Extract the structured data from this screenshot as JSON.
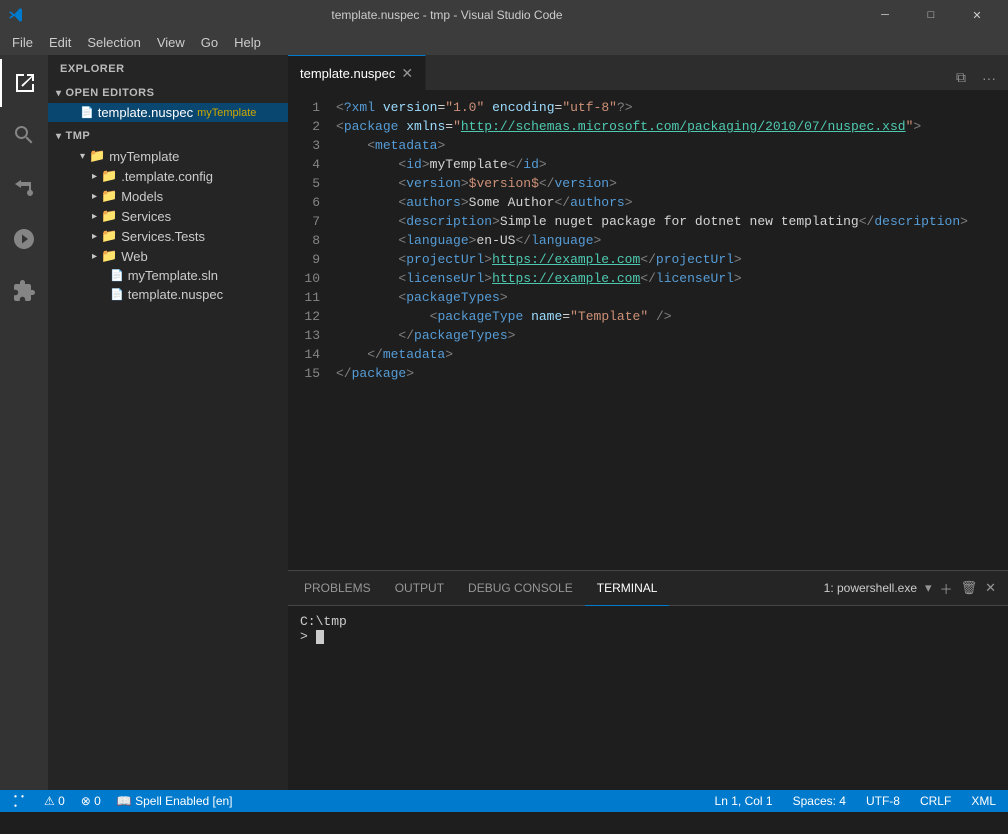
{
  "titlebar": {
    "title": "template.nuspec - tmp - Visual Studio Code",
    "icon": "⚡",
    "minimize": "─",
    "maximize": "□",
    "close": "✕"
  },
  "menubar": {
    "items": [
      "File",
      "Edit",
      "Selection",
      "View",
      "Go",
      "Help"
    ]
  },
  "sidebar": {
    "title": "Explorer",
    "sections": {
      "open_editors": "Open Editors",
      "tmp": "TMP"
    },
    "open_editors_items": [
      {
        "name": "template.nuspec",
        "badge": "myTemplate"
      }
    ],
    "tree": [
      {
        "label": "myTemplate",
        "level": 1,
        "expanded": true
      },
      {
        "label": ".template.config",
        "level": 2
      },
      {
        "label": "Models",
        "level": 2
      },
      {
        "label": "Services",
        "level": 2
      },
      {
        "label": "Services.Tests",
        "level": 2
      },
      {
        "label": "Web",
        "level": 2
      },
      {
        "label": "myTemplate.sln",
        "level": 2,
        "isFile": true
      },
      {
        "label": "template.nuspec",
        "level": 2,
        "isFile": true
      }
    ]
  },
  "editor": {
    "tab": {
      "filename": "template.nuspec",
      "modified": false
    },
    "lines": [
      {
        "num": 1,
        "content": "<?xml version=\"1.0\" encoding=\"utf-8\"?>"
      },
      {
        "num": 2,
        "content": "<package xmlns=\"http://schemas.microsoft.com/packaging/2010/07/nuspec.xsd\">"
      },
      {
        "num": 3,
        "content": "    <metadata>"
      },
      {
        "num": 4,
        "content": "        <id>myTemplate</id>"
      },
      {
        "num": 5,
        "content": "        <version>$version$</version>"
      },
      {
        "num": 6,
        "content": "        <authors>Some Author</authors>"
      },
      {
        "num": 7,
        "content": "        <description>Simple nuget package for dotnet new templating</description>"
      },
      {
        "num": 8,
        "content": "        <language>en-US</language>"
      },
      {
        "num": 9,
        "content": "        <projectUrl>https://example.com</projectUrl>"
      },
      {
        "num": 10,
        "content": "        <licenseUrl>https://example.com</licenseUrl>"
      },
      {
        "num": 11,
        "content": "        <packageTypes>"
      },
      {
        "num": 12,
        "content": "            <packageType name=\"Template\" />"
      },
      {
        "num": 13,
        "content": "        </packageTypes>"
      },
      {
        "num": 14,
        "content": "    </metadata>"
      },
      {
        "num": 15,
        "content": "</package>"
      }
    ]
  },
  "terminal": {
    "tabs": [
      "PROBLEMS",
      "OUTPUT",
      "DEBUG CONSOLE",
      "TERMINAL"
    ],
    "active_tab": "TERMINAL",
    "shell_name": "1: powershell.exe",
    "prompt": "C:\\tmp",
    "cursor_line": "> "
  },
  "statusbar": {
    "left": [
      "⚠ 0",
      "⊗ 0",
      "Spell Enabled [en]"
    ],
    "right": [
      "Ln 1, Col 1",
      "Spaces: 4",
      "UTF-8",
      "CRLF",
      "XML"
    ]
  }
}
